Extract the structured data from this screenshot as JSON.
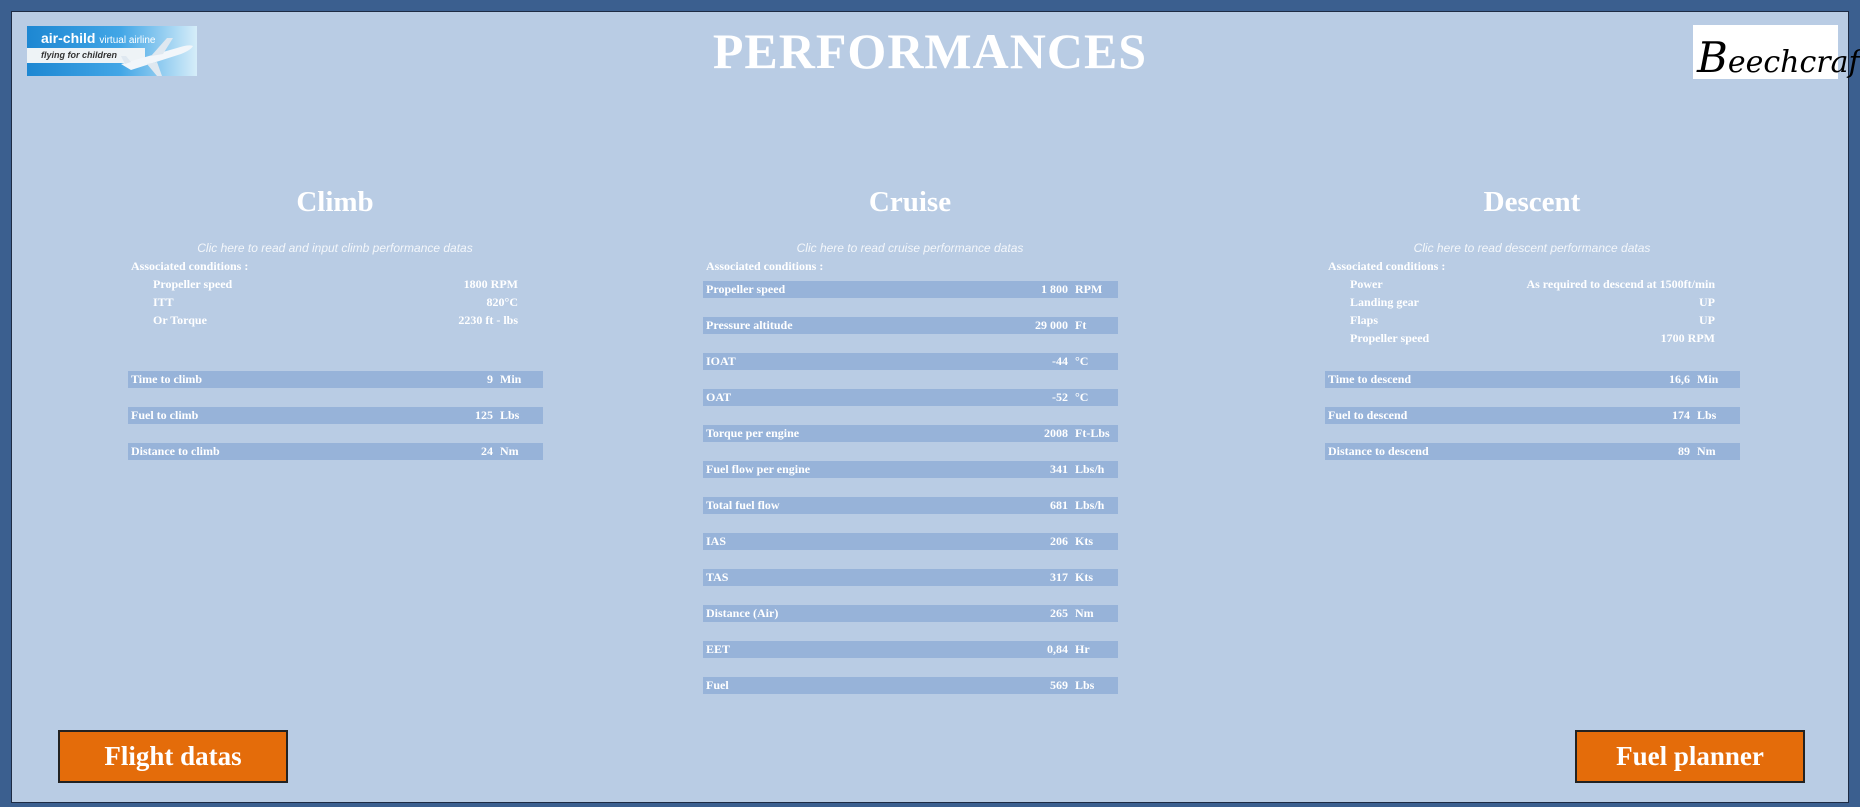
{
  "page": {
    "title": "PERFORMANCES"
  },
  "logos": {
    "left": {
      "brand": "air-child",
      "sub": "virtual airline",
      "tagline": "flying for children"
    },
    "right": {
      "initial": "B",
      "rest": "eechcraft"
    }
  },
  "climb": {
    "title": "Climb",
    "hint": "Clic here to read and input climb performance datas",
    "conditions_label": "Associated conditions :",
    "conditions": [
      {
        "label": "Propeller speed",
        "value": "1800 RPM"
      },
      {
        "label": "ITT",
        "value": "820°C"
      },
      {
        "label": "Or Torque",
        "value": "2230 ft - lbs"
      }
    ],
    "rows": [
      {
        "label": "Time to climb",
        "value": "9",
        "unit": "Min"
      },
      {
        "label": "Fuel to climb",
        "value": "125",
        "unit": "Lbs"
      },
      {
        "label": "Distance to climb",
        "value": "24",
        "unit": "Nm"
      }
    ]
  },
  "cruise": {
    "title": "Cruise",
    "hint": "Clic here to read cruise performance datas",
    "conditions_label": "Associated conditions :",
    "rows": [
      {
        "label": "Propeller speed",
        "value": "1 800",
        "unit": "RPM"
      },
      {
        "label": "Pressure altitude",
        "value": "29 000",
        "unit": "Ft"
      },
      {
        "label": "IOAT",
        "value": "-44",
        "unit": "°C"
      },
      {
        "label": "OAT",
        "value": "-52",
        "unit": "°C"
      },
      {
        "label": "Torque per engine",
        "value": "2008",
        "unit": "Ft-Lbs"
      },
      {
        "label": "Fuel flow per engine",
        "value": "341",
        "unit": "Lbs/h"
      },
      {
        "label": "Total fuel flow",
        "value": "681",
        "unit": "Lbs/h"
      },
      {
        "label": "IAS",
        "value": "206",
        "unit": "Kts"
      },
      {
        "label": "TAS",
        "value": "317",
        "unit": "Kts"
      },
      {
        "label": "Distance (Air)",
        "value": "265",
        "unit": "Nm"
      },
      {
        "label": "EET",
        "value": "0,84",
        "unit": "Hr"
      },
      {
        "label": "Fuel",
        "value": "569",
        "unit": "Lbs"
      }
    ]
  },
  "descent": {
    "title": "Descent",
    "hint": "Clic here to read descent performance datas",
    "conditions_label": "Associated conditions :",
    "conditions": [
      {
        "label": "Power",
        "value": "As required to descend at 1500ft/min"
      },
      {
        "label": "Landing gear",
        "value": "UP"
      },
      {
        "label": "Flaps",
        "value": "UP"
      },
      {
        "label": "Propeller speed",
        "value": "1700 RPM"
      }
    ],
    "rows": [
      {
        "label": "Time to descend",
        "value": "16,6",
        "unit": "Min"
      },
      {
        "label": "Fuel to descend",
        "value": "174",
        "unit": "Lbs"
      },
      {
        "label": "Distance to descend",
        "value": "89",
        "unit": "Nm"
      }
    ]
  },
  "buttons": {
    "flight_datas": "Flight datas",
    "fuel_planner": "Fuel planner"
  },
  "colors": {
    "sheet": "#b9cce4",
    "row": "#97b3d9",
    "button": "#e46c0a"
  }
}
